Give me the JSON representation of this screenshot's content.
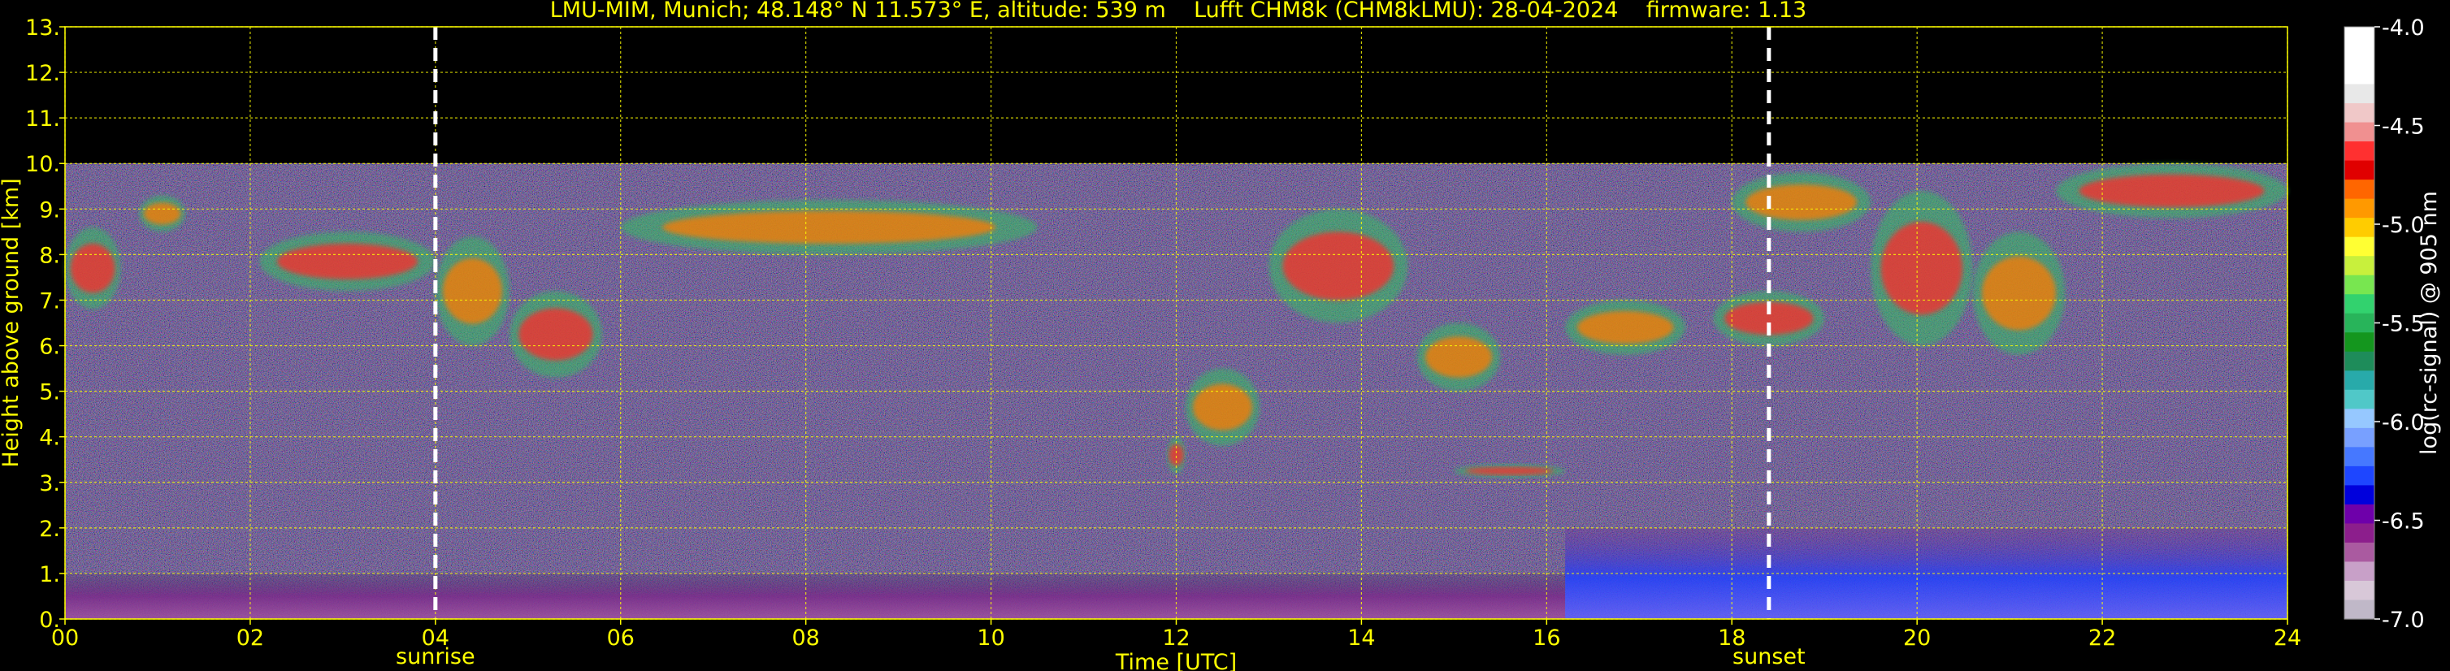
{
  "chart_data": {
    "type": "heatmap",
    "title": "LMU-MIM, Munich; 48.148° N 11.573° E, altitude: 539 m    Lufft CHM8k (CHM8kLMU): 28-04-2024    firmware: 1.13",
    "xlabel": "Time [UTC]",
    "ylabel": "Height above ground [km]",
    "xlim": [
      0,
      24
    ],
    "ylim": [
      0,
      13
    ],
    "x_ticks": [
      "00",
      "02",
      "04",
      "06",
      "08",
      "10",
      "12",
      "14",
      "16",
      "18",
      "20",
      "22",
      "24"
    ],
    "y_ticks": [
      "0.",
      "1.",
      "2.",
      "3.",
      "4.",
      "5.",
      "6.",
      "7.",
      "8.",
      "9.",
      "10.",
      "11.",
      "12.",
      "13."
    ],
    "grid": true,
    "data_top_km": 10,
    "markers": [
      {
        "label": "sunrise",
        "x": 4.0
      },
      {
        "label": "sunset",
        "x": 18.4
      }
    ],
    "colorbar": {
      "label": "log(rc-signal) @ 905 nm",
      "range": [
        -7.0,
        -4.0
      ],
      "ticks": [
        "-4.0",
        "-4.5",
        "-5.0",
        "-5.5",
        "-6.0",
        "-6.5",
        "-7.0"
      ],
      "colors": [
        "#ffffff",
        "#ffffff",
        "#ffffff",
        "#e8e8e8",
        "#f0c8c8",
        "#f09090",
        "#ff3030",
        "#e00000",
        "#ff6600",
        "#ff9900",
        "#ffcc00",
        "#ffff33",
        "#c8f03c",
        "#78e650",
        "#32d26e",
        "#28b45a",
        "#14961e",
        "#1e8c5a",
        "#28aaaa",
        "#50c8c8",
        "#96c8ff",
        "#78a0ff",
        "#4678ff",
        "#1e46ff",
        "#0000dc",
        "#6e00aa",
        "#8c1e8c",
        "#aa5aa0",
        "#c8a0c8",
        "#d8c8d8",
        "#c0b8c8"
      ]
    },
    "cloud_layers": [
      {
        "t": [
          0.0,
          0.6
        ],
        "h": [
          6.8,
          8.6
        ]
      },
      {
        "t": [
          0.8,
          1.3
        ],
        "h": [
          8.5,
          9.3
        ]
      },
      {
        "t": [
          2.1,
          4.0
        ],
        "h": [
          7.2,
          8.5
        ]
      },
      {
        "t": [
          4.0,
          4.8
        ],
        "h": [
          6.0,
          8.4
        ]
      },
      {
        "t": [
          4.8,
          5.8
        ],
        "h": [
          5.3,
          7.2
        ]
      },
      {
        "t": [
          6.0,
          10.5
        ],
        "h": [
          8.0,
          9.2
        ]
      },
      {
        "t": [
          11.9,
          12.1
        ],
        "h": [
          3.2,
          4.0
        ]
      },
      {
        "t": [
          12.1,
          12.9
        ],
        "h": [
          3.8,
          5.5
        ]
      },
      {
        "t": [
          13.0,
          14.5
        ],
        "h": [
          6.5,
          9.0
        ]
      },
      {
        "t": [
          14.6,
          15.5
        ],
        "h": [
          5.0,
          6.5
        ]
      },
      {
        "t": [
          15.0,
          16.2
        ],
        "h": [
          3.1,
          3.4
        ]
      },
      {
        "t": [
          16.2,
          17.5
        ],
        "h": [
          5.8,
          7.0
        ]
      },
      {
        "t": [
          17.8,
          19.0
        ],
        "h": [
          6.0,
          7.2
        ]
      },
      {
        "t": [
          18.0,
          19.5
        ],
        "h": [
          8.5,
          9.8
        ]
      },
      {
        "t": [
          19.5,
          20.6
        ],
        "h": [
          6.0,
          9.4
        ]
      },
      {
        "t": [
          20.6,
          21.6
        ],
        "h": [
          5.8,
          8.5
        ]
      },
      {
        "t": [
          21.5,
          24.0
        ],
        "h": [
          8.8,
          10.0
        ]
      }
    ],
    "boundary_layer": [
      {
        "t": [
          0.0,
          16.2
        ],
        "h": [
          0.0,
          1.0
        ]
      },
      {
        "t": [
          16.2,
          24.0
        ],
        "h": [
          0.0,
          2.0
        ]
      }
    ]
  }
}
